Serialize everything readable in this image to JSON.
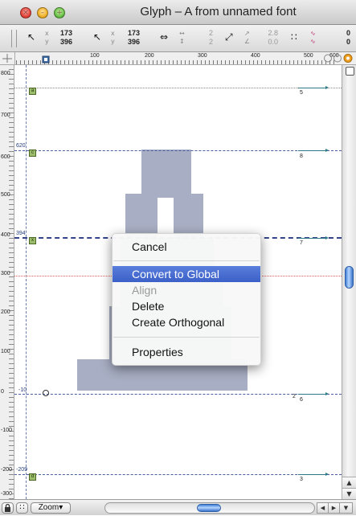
{
  "window": {
    "title": "Glyph – A from unnamed font"
  },
  "titlebar_buttons": {
    "close_glyph": "×",
    "minimize_glyph": "–",
    "zoom_glyph": "+"
  },
  "toolbar": {
    "groups": [
      {
        "icon": "↖",
        "xl": "x",
        "yl": "y",
        "x": "173",
        "y": "396"
      },
      {
        "icon": "↖",
        "xl": "x",
        "yl": "y",
        "x": "173",
        "y": "396"
      },
      {
        "icon": "⇔",
        "xl": "↔",
        "yl": "↕",
        "x": "2",
        "y": "2"
      },
      {
        "icon": "⤢",
        "xl": "↗",
        "yl": "∠",
        "x": "2.8",
        "y": "0.0"
      },
      {
        "icon": "∷",
        "xl": "∿",
        "yl": "∿",
        "x": "0",
        "y": "0"
      }
    ]
  },
  "ruler_h": [
    "100",
    "200",
    "300",
    "400",
    "500",
    "600"
  ],
  "ruler_v": [
    "800",
    "700",
    "600",
    "500",
    "400",
    "300",
    "200",
    "100",
    "0",
    "-100",
    "-200",
    "-300"
  ],
  "guides": {
    "labels": {
      "g620": "620",
      "g394": "394",
      "g10": "-10",
      "g209": "-209"
    },
    "badges": {
      "a": "a",
      "c": "c",
      "x": "x",
      "d": "d"
    },
    "hint_numbers": {
      "h5": "5",
      "h8": "8",
      "h7": "7",
      "h6": "6",
      "h2": "2",
      "h3": "3"
    }
  },
  "context_menu": {
    "items": {
      "cancel": "Cancel",
      "convert": "Convert to Global",
      "align": "Align",
      "delete": "Delete",
      "orthogonal": "Create Orthogonal",
      "properties": "Properties"
    }
  },
  "statusbar": {
    "zoom_label": "Zoom▾",
    "lock_glyph": "🔒",
    "grid_glyph": "∷"
  },
  "colors": {
    "glyph_fill": "#a8aec3",
    "selection": "#3b60c8",
    "guide": "#4a5fa0"
  }
}
